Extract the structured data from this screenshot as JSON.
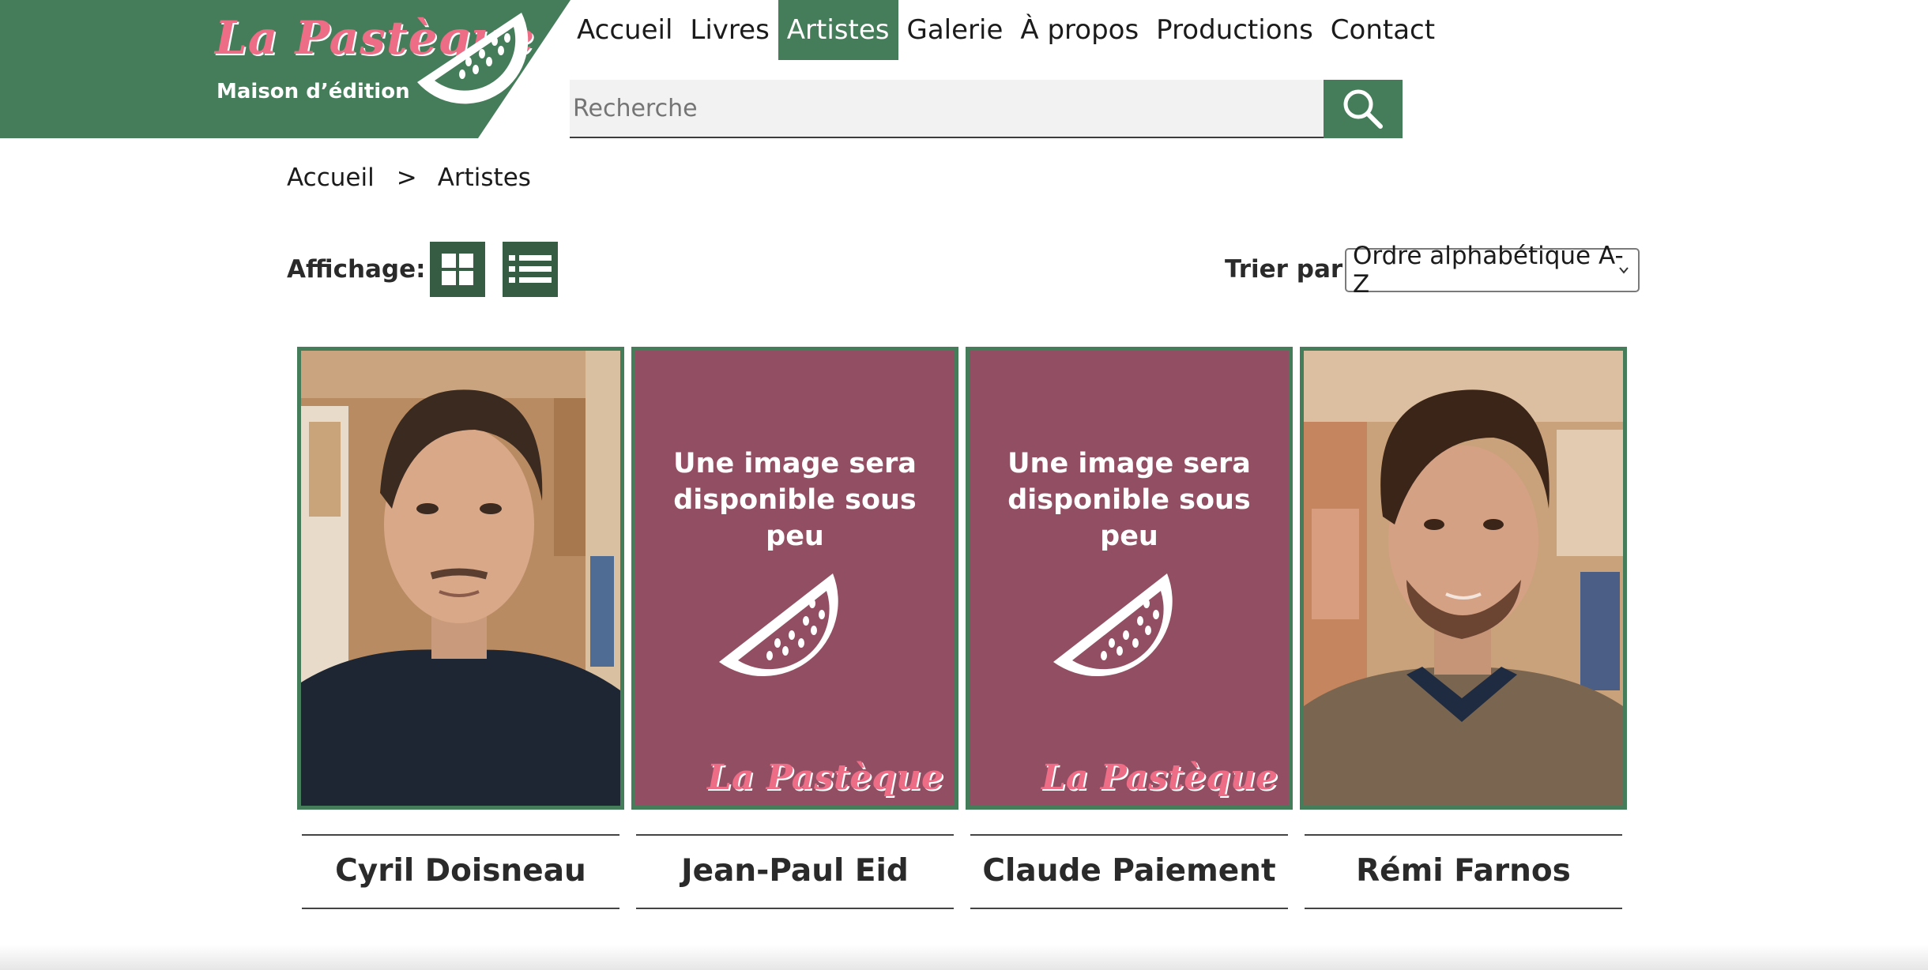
{
  "brand": {
    "name": "La Pastèque",
    "tagline": "Maison d’édition",
    "green": "#457d5a",
    "dark_green": "#365d44",
    "pink": "#ee6d86",
    "placeholder_bg": "#924f64"
  },
  "nav": {
    "items": [
      "Accueil",
      "Livres",
      "Artistes",
      "Galerie",
      "À propos",
      "Productions",
      "Contact"
    ],
    "active": "Artistes"
  },
  "search": {
    "placeholder": "Recherche",
    "icon": "search-icon"
  },
  "breadcrumb": {
    "home": "Accueil",
    "separator": ">",
    "current": "Artistes"
  },
  "toolbar": {
    "display_label": "Affichage:",
    "grid_icon": "grid-view-icon",
    "list_icon": "list-view-icon",
    "sort_label": "Trier par:",
    "sort_value": "Ordre alphabétique A-Z"
  },
  "artists": [
    {
      "name": "Cyril Doisneau",
      "image": "photo"
    },
    {
      "name": "Jean-Paul Eid",
      "image": "placeholder"
    },
    {
      "name": "Claude Paiement",
      "image": "placeholder"
    },
    {
      "name": "Rémi Farnos",
      "image": "photo"
    }
  ],
  "placeholder": {
    "text": "Une image sera disponible sous peu",
    "logo": "La Pastèque"
  }
}
